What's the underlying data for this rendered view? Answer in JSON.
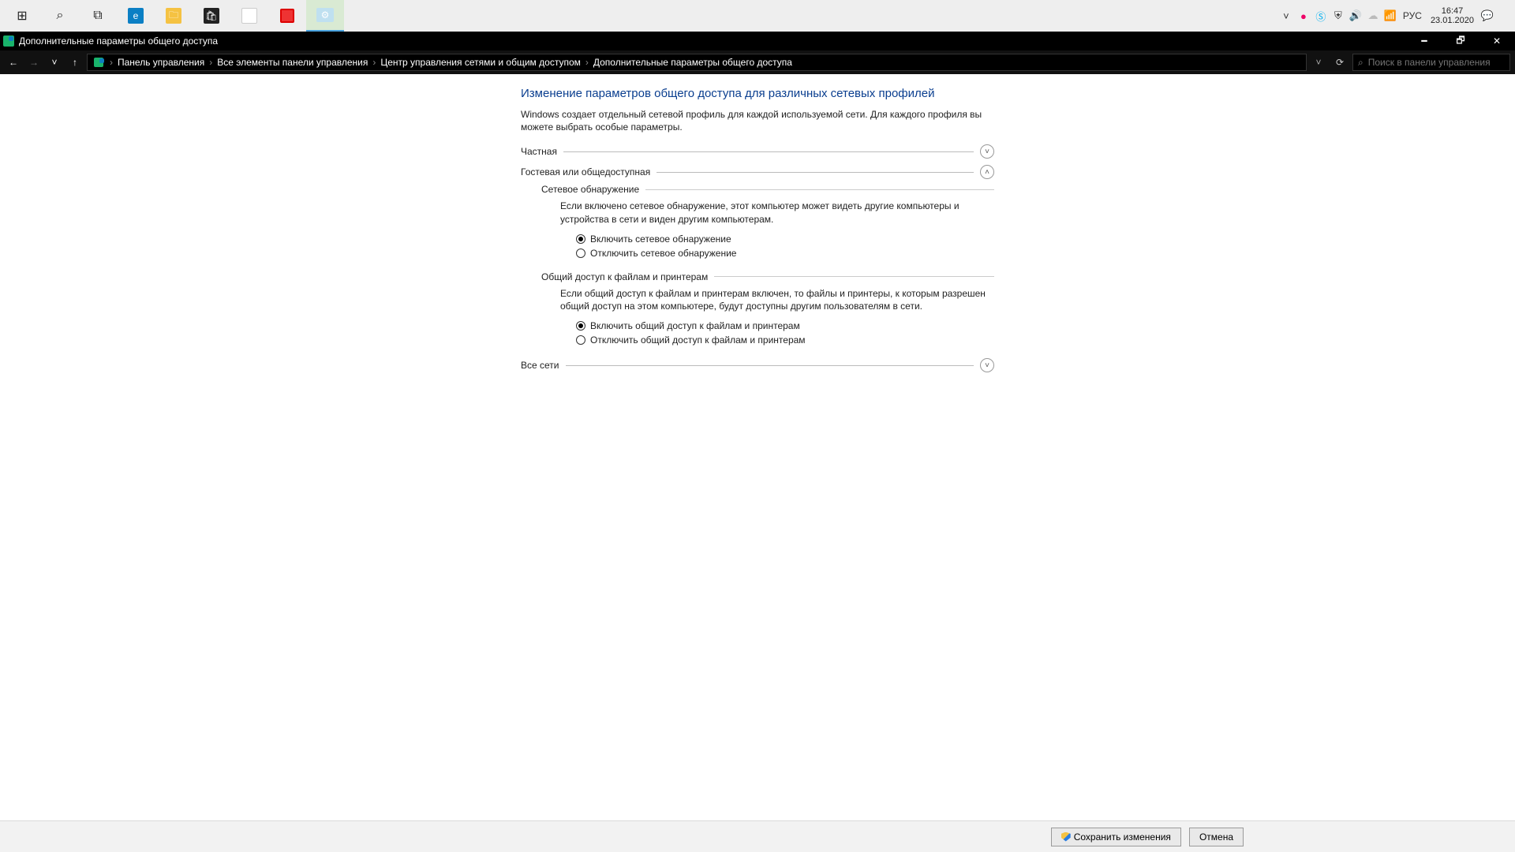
{
  "taskbar": {
    "tray_lang": "РУС",
    "clock_time": "16:47",
    "clock_date": "23.01.2020"
  },
  "window": {
    "title": "Дополнительные параметры общего доступа"
  },
  "breadcrumb": {
    "seg0": "Панель управления",
    "seg1": "Все элементы панели управления",
    "seg2": "Центр управления сетями и общим доступом",
    "seg3": "Дополнительные параметры общего доступа"
  },
  "search": {
    "placeholder": "Поиск в панели управления"
  },
  "page": {
    "title": "Изменение параметров общего доступа для различных сетевых профилей",
    "desc": "Windows создает отдельный сетевой профиль для каждой используемой сети. Для каждого профиля вы можете выбрать особые параметры."
  },
  "sections": {
    "private_label": "Частная",
    "guest_label": "Гостевая или общедоступная",
    "all_label": "Все сети"
  },
  "network_discovery": {
    "group_title": "Сетевое обнаружение",
    "desc": "Если включено сетевое обнаружение, этот компьютер может видеть другие компьютеры и устройства в сети и виден другим компьютерам.",
    "opt_on": "Включить сетевое обнаружение",
    "opt_off": "Отключить сетевое обнаружение"
  },
  "file_sharing": {
    "group_title": "Общий доступ к файлам и принтерам",
    "desc": "Если общий доступ к файлам и принтерам включен, то файлы и принтеры, к которым разрешен общий доступ на этом компьютере, будут доступны другим пользователям в сети.",
    "opt_on": "Включить общий доступ к файлам и принтерам",
    "opt_off": "Отключить общий доступ к файлам и принтерам"
  },
  "footer": {
    "save": "Сохранить изменения",
    "cancel": "Отмена"
  }
}
